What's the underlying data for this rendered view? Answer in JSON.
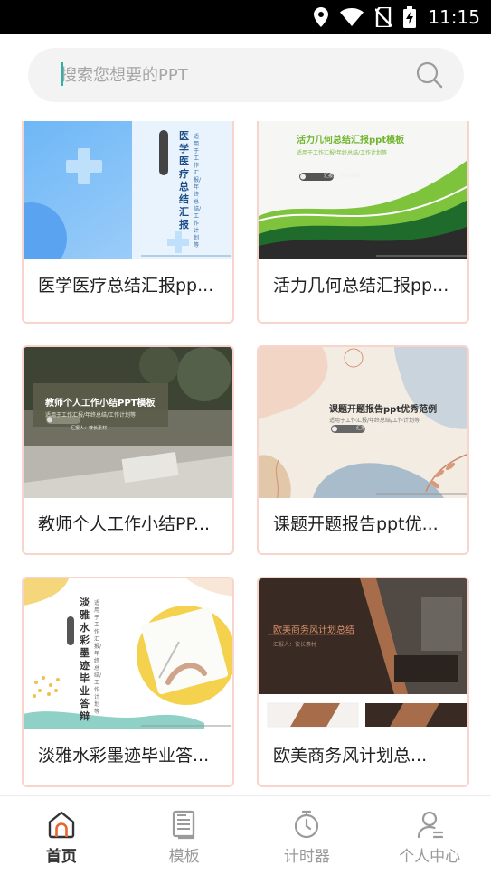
{
  "status_bar": {
    "time": "11:15",
    "icons": [
      "location-icon",
      "wifi-icon",
      "no-sim-icon",
      "battery-charging-icon"
    ]
  },
  "search": {
    "placeholder": "搜索您想要的PPT",
    "icon": "search-icon"
  },
  "cards": [
    {
      "title": "医学医疗总结汇报pp...",
      "thumb_title": "医学医疗总结汇报",
      "thumb_sub": "适用于工作汇报/年终总结/工作计划等"
    },
    {
      "title": "活力几何总结汇报pp...",
      "thumb_title": "活力几何总结汇报ppt模板",
      "thumb_sub": "适用于工作汇报/年终总结/工作计划等",
      "thumb_pill": "汇报人：彼长素材"
    },
    {
      "title": "教师个人工作小结PP...",
      "thumb_title": "教师个人工作小结PPT模板",
      "thumb_sub": "适用于工作汇报/年终总结/工作计划等",
      "thumb_pill": "汇报人：彼长素材"
    },
    {
      "title": "课题开题报告ppt优...",
      "thumb_title": "课题开题报告ppt优秀范例",
      "thumb_sub": "适用于工作汇报/年终总结/工作计划等",
      "thumb_pill": "汇报人：彼长素材"
    },
    {
      "title": "淡雅水彩墨迹毕业答...",
      "thumb_title": "淡雅水彩墨迹毕业答辩",
      "thumb_sub": "适用于工作汇报/年终总结/工作计划等"
    },
    {
      "title": "欧美商务风计划总...",
      "thumb_title": "欧美商务风计划总结",
      "thumb_sub": "汇报人：彼长素材"
    }
  ],
  "nav": [
    {
      "label": "首页",
      "icon": "home-icon",
      "active": true
    },
    {
      "label": "模板",
      "icon": "template-icon",
      "active": false
    },
    {
      "label": "计时器",
      "icon": "timer-icon",
      "active": false
    },
    {
      "label": "个人中心",
      "icon": "profile-icon",
      "active": false
    }
  ],
  "colors": {
    "accent": "#e8662c",
    "card_border": "#f7d4cc",
    "search_bg": "#f3f3f3",
    "inactive": "#9a9a9a",
    "caret": "#2bb3a8"
  }
}
